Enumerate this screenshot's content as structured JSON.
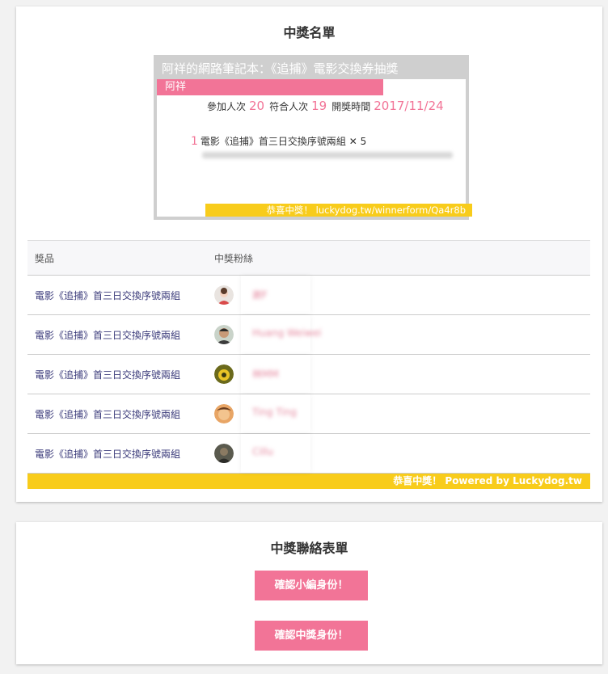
{
  "winner_list": {
    "title": "中獎名單",
    "banner": {
      "title": "阿祥的網路筆記本：《追捕》電影交換券抽獎",
      "owner": "阿祥",
      "participants_label": "參加人次",
      "participants": "20",
      "eligible_label": "符合人次",
      "eligible": "19",
      "draw_time_label": "開獎時間",
      "draw_time": "2017/11/24",
      "prize_index": "1",
      "prize_text": "電影《追捕》首三日交換序號兩組 ✕ 5",
      "footer": "恭喜中獎！ luckydog.tw/winnerform/Qa4r8b"
    },
    "table": {
      "columns": [
        "獎品",
        "中獎粉絲"
      ],
      "rows": [
        {
          "prize": "電影《追捕》首三日交換序號兩組",
          "fan": "謝F"
        },
        {
          "prize": "電影《追捕》首三日交換序號兩組",
          "fan": "Huang Weiwei"
        },
        {
          "prize": "電影《追捕》首三日交換序號兩組",
          "fan": "林MM"
        },
        {
          "prize": "電影《追捕》首三日交換序號兩組",
          "fan": "Ting Ting"
        },
        {
          "prize": "電影《追捕》首三日交換序號兩組",
          "fan": "Cillu"
        }
      ],
      "footer": "恭喜中獎！ Powered by Luckydog.tw"
    }
  },
  "contact_form": {
    "title": "中獎聯絡表單",
    "buttons": [
      "確認小編身份！",
      "確認中獎身份！"
    ]
  },
  "colors": {
    "accent_pink": "#f27497",
    "accent_yellow": "#f8cc1b"
  }
}
